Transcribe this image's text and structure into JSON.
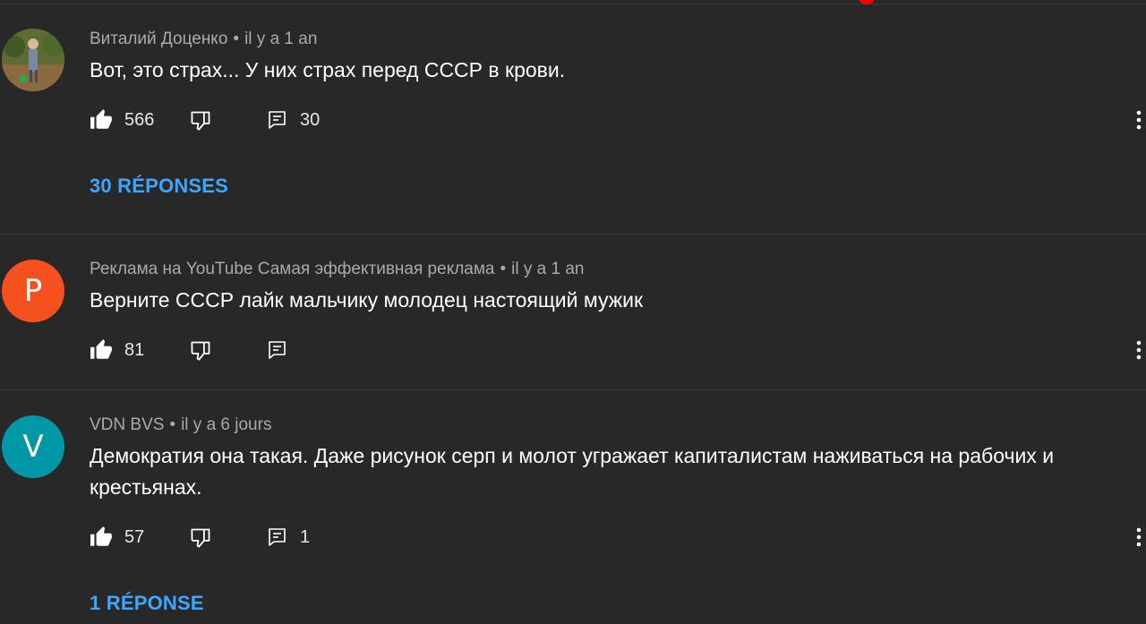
{
  "colors": {
    "background": "#282828",
    "link": "#3ea6ff",
    "meta": "#aaaaaa",
    "avatar_p": "#f4511e",
    "avatar_v": "#0097a7",
    "progress": "#ff0000"
  },
  "comments": [
    {
      "author": "Виталий Доценко",
      "separator": "•",
      "time": "il y a 1 an",
      "text": "Вот, это страх... У них страх перед СССР в крови.",
      "likes": "566",
      "replies_count": "30",
      "replies_link": "30 RÉPONSES",
      "avatar_icon": "photo"
    },
    {
      "author": "Реклама на YouTube Самая эффективная реклама",
      "separator": "•",
      "time": "il y a 1 an",
      "text": "Верните СССР лайк мальчику молодец настоящий мужик",
      "likes": "81",
      "replies_count": "",
      "avatar_letter": "P"
    },
    {
      "author": "VDN BVS",
      "separator": "•",
      "time": "il y a 6 jours",
      "text": "Демократия она такая. Даже рисунок серп и молот угражает капиталистам наживаться на рабочих и крестьянах.",
      "likes": "57",
      "replies_count": "1",
      "replies_link": "1 RÉPONSE",
      "avatar_letter": "V"
    }
  ],
  "icons": {
    "like": "thumbs-up-icon",
    "dislike": "thumbs-down-icon",
    "reply": "reply-icon",
    "more": "more-vert-icon"
  }
}
